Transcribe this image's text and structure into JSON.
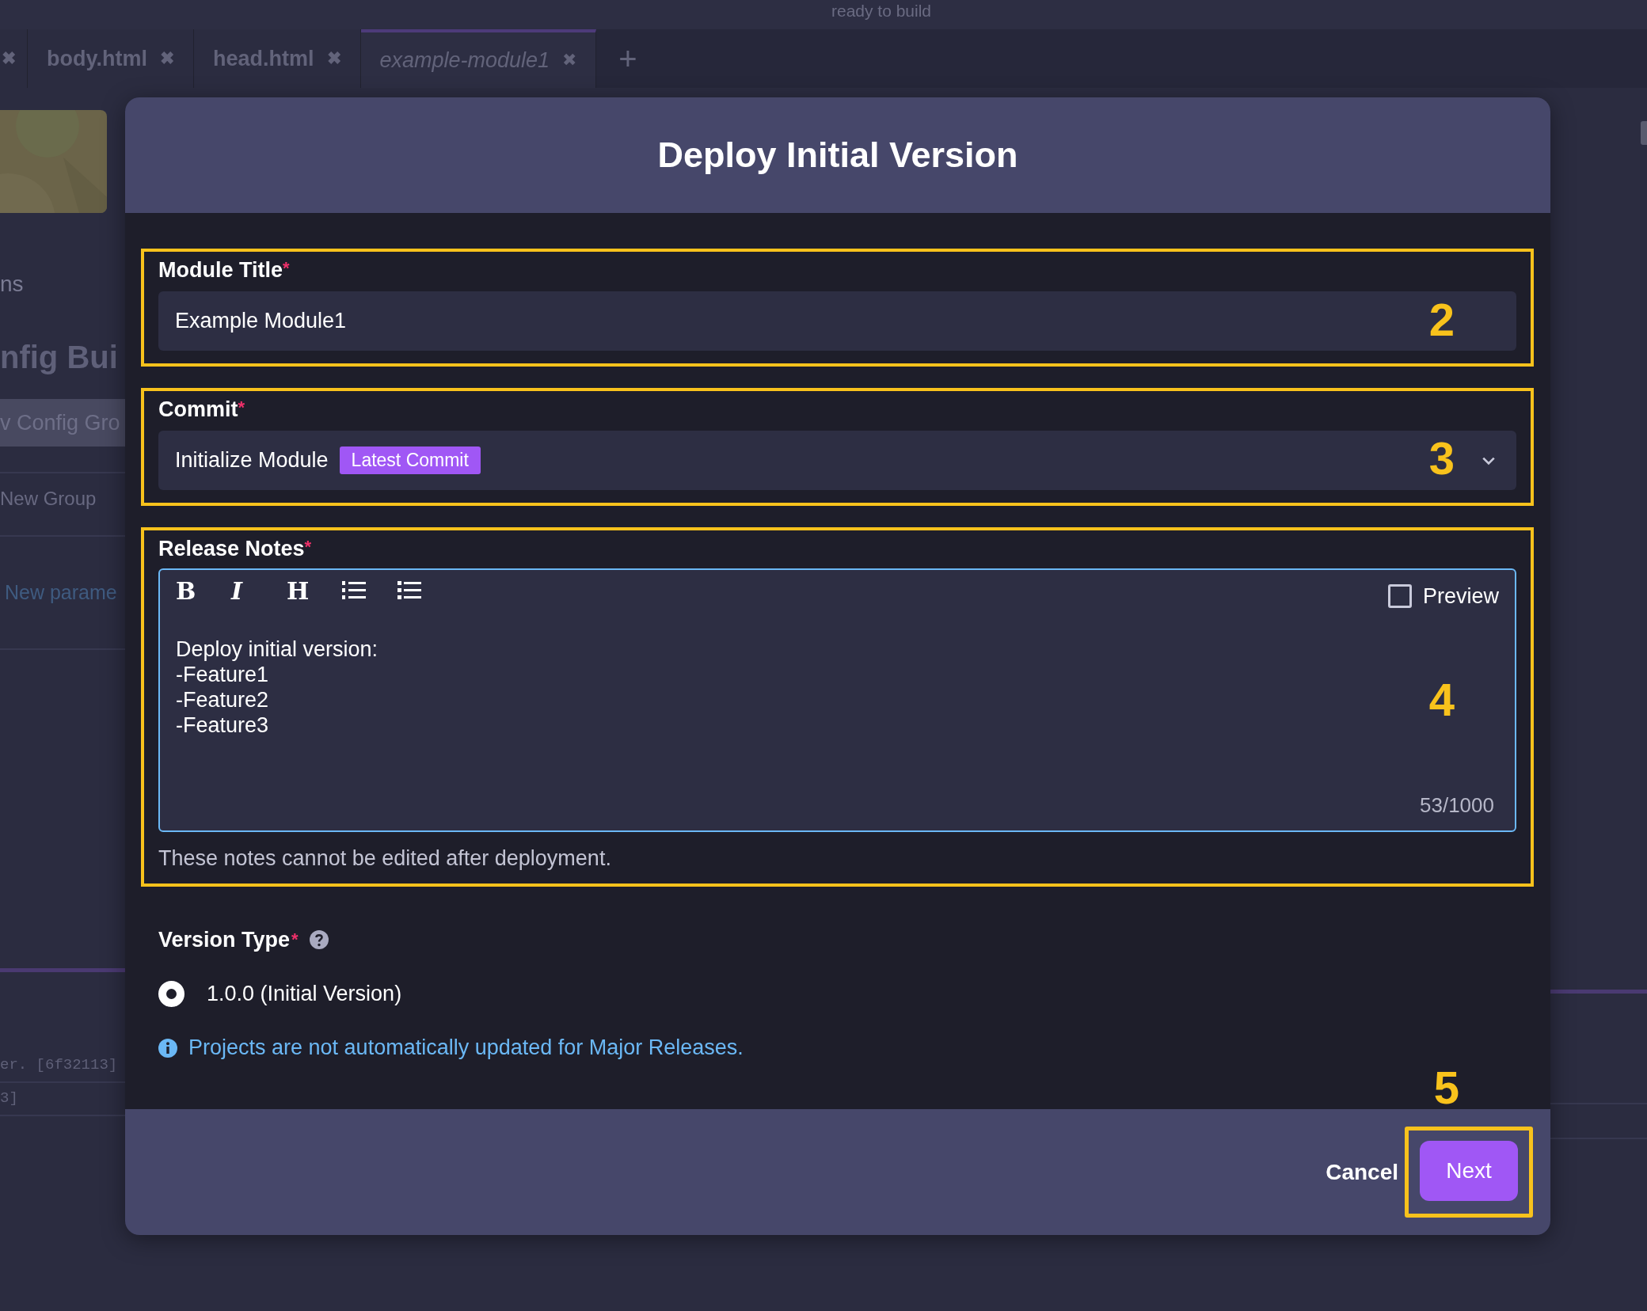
{
  "status_text": "ready to build",
  "partial_tab": {
    "close": "✖"
  },
  "tabs": [
    {
      "label": "body.html",
      "close": "✖",
      "selected": false
    },
    {
      "label": "head.html",
      "close": "✖",
      "selected": false
    },
    {
      "label": "example-module1",
      "close": "✖",
      "selected": true
    }
  ],
  "new_tab": "+",
  "background": {
    "section_label": "ns",
    "heading": "nfig Bui",
    "group_button": "v Config Gro",
    "group_item": "New Group",
    "param_link": "New parame",
    "log_lines": [
      "er. [6f32113]",
      "3]"
    ]
  },
  "dialog": {
    "title": "Deploy Initial Version",
    "module_title": {
      "label": "Module Title",
      "required_mark": "*",
      "value": "Example Module1",
      "annotation": "2"
    },
    "commit": {
      "label": "Commit",
      "required_mark": "*",
      "value": "Initialize Module",
      "badge": "Latest Commit",
      "annotation": "3"
    },
    "release_notes": {
      "label": "Release Notes",
      "required_mark": "*",
      "toolbar": [
        {
          "kind": "bold",
          "label": "B"
        },
        {
          "kind": "italic",
          "label": "I"
        },
        {
          "kind": "heading",
          "label": "H"
        },
        {
          "kind": "ordered-list"
        },
        {
          "kind": "bullet-list"
        }
      ],
      "preview": {
        "label": "Preview",
        "checked": false
      },
      "value": "Deploy initial version:\n-Feature1\n-Feature2\n-Feature3",
      "counter": "53/1000",
      "hint": "These notes cannot be edited after deployment.",
      "annotation": "4"
    },
    "version_type": {
      "label": "Version Type",
      "required_mark": "*",
      "options": [
        {
          "label": "1.0.0 (Initial Version)",
          "selected": true
        }
      ],
      "info": "Projects are not automatically updated for Major Releases."
    },
    "footer": {
      "cancel": "Cancel",
      "next": "Next",
      "annotation": "5"
    }
  }
}
